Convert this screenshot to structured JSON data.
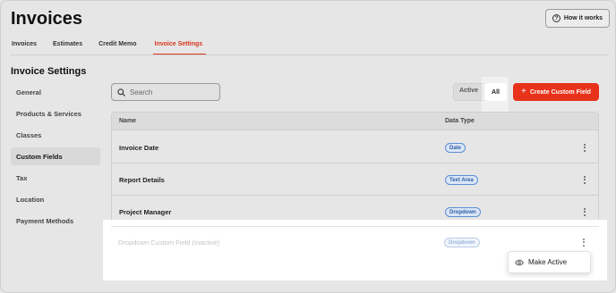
{
  "header": {
    "title": "Invoices",
    "how_it_works": "How it works"
  },
  "tabs": [
    {
      "label": "Invoices"
    },
    {
      "label": "Estimates"
    },
    {
      "label": "Credit Memo"
    },
    {
      "label": "Invoice Settings",
      "active": true
    }
  ],
  "section_title": "Invoice Settings",
  "sidebar": {
    "items": [
      {
        "label": "General"
      },
      {
        "label": "Products & Services"
      },
      {
        "label": "Classes"
      },
      {
        "label": "Custom Fields",
        "active": true
      },
      {
        "label": "Tax"
      },
      {
        "label": "Location"
      },
      {
        "label": "Payment Methods"
      }
    ]
  },
  "toolbar": {
    "search_placeholder": "Search",
    "filter_active": "Active",
    "filter_all": "All",
    "create_label": "Create Custom Field"
  },
  "table": {
    "columns": [
      "Name",
      "Data Type"
    ],
    "rows": [
      {
        "name": "Invoice Date",
        "type": "Date"
      },
      {
        "name": "Report Details",
        "type": "Text Area"
      },
      {
        "name": "Project Manager",
        "type": "Dropdown"
      }
    ],
    "inactive_row": {
      "name": "Dropdown Custom Field (Inactive)",
      "type": "Dropdown"
    }
  },
  "menu": {
    "make_active": "Make Active"
  },
  "colors": {
    "accent": "#e8321a",
    "badge_border": "#5b8ed6",
    "badge_bg": "#dbe6f5"
  }
}
